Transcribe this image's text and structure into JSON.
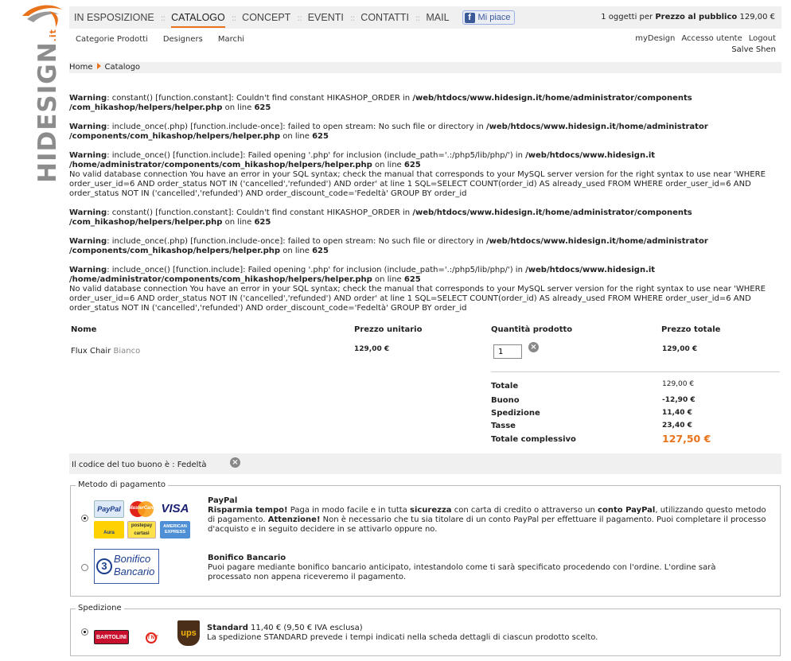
{
  "logo": {
    "brand": "HIDESIGN",
    "tld": ".it"
  },
  "nav": {
    "items": [
      {
        "label": "IN ESPOSIZIONE",
        "active": false
      },
      {
        "label": "CATALOGO",
        "active": true
      },
      {
        "label": "CONCEPT",
        "active": false
      },
      {
        "label": "EVENTI",
        "active": false
      },
      {
        "label": "CONTATTI",
        "active": false
      },
      {
        "label": "MAIL",
        "active": false
      }
    ],
    "separator": "::",
    "fb_like": "Mi piace",
    "cart": {
      "count_text": "1 oggetti per",
      "price_label": "Prezzo al pubblico",
      "total": "129,00 €"
    }
  },
  "subnav": [
    "Categorie Prodotti",
    "Designers",
    "Marchi"
  ],
  "usernav": [
    "myDesign",
    "Accesso utente",
    "Logout"
  ],
  "greeting": "Salve Shen",
  "breadcrumb": {
    "home": "Home",
    "current": "Catalogo"
  },
  "warnings": [
    {
      "label": "Warning",
      "text": ": constant() [function.constant]: Couldn't find constant HIKASHOP_ORDER in ",
      "path": "/web/htdocs/www.hidesign.it/home/administrator/components /com_hikashop/helpers/helper.php",
      "line_text": " on line ",
      "line": "625",
      "extra": ""
    },
    {
      "label": "Warning",
      "text": ": include_once(.php) [function.include-once]: failed to open stream: No such file or directory in ",
      "path": "/web/htdocs/www.hidesign.it/home/administrator /components/com_hikashop/helpers/helper.php",
      "line_text": " on line ",
      "line": "625",
      "extra": ""
    },
    {
      "label": "Warning",
      "text": ": include_once() [function.include]: Failed opening '.php' for inclusion (include_path='.:/php5/lib/php/') in ",
      "path": "/web/htdocs/www.hidesign.it /home/administrator/components/com_hikashop/helpers/helper.php",
      "line_text": " on line ",
      "line": "625",
      "extra": "No valid database connection You have an error in your SQL syntax; check the manual that corresponds to your MySQL server version for the right syntax to use near 'WHERE order_user_id=6 AND order_status NOT IN ('cancelled','refunded') AND order' at line 1 SQL=SELECT COUNT(order_id) AS already_used FROM WHERE order_user_id=6 AND order_status NOT IN ('cancelled','refunded') AND order_discount_code='Fedeltà' GROUP BY order_id"
    },
    {
      "label": "Warning",
      "text": ": constant() [function.constant]: Couldn't find constant HIKASHOP_ORDER in ",
      "path": "/web/htdocs/www.hidesign.it/home/administrator/components /com_hikashop/helpers/helper.php",
      "line_text": " on line ",
      "line": "625",
      "extra": ""
    },
    {
      "label": "Warning",
      "text": ": include_once(.php) [function.include-once]: failed to open stream: No such file or directory in ",
      "path": "/web/htdocs/www.hidesign.it/home/administrator /components/com_hikashop/helpers/helper.php",
      "line_text": " on line ",
      "line": "625",
      "extra": ""
    },
    {
      "label": "Warning",
      "text": ": include_once() [function.include]: Failed opening '.php' for inclusion (include_path='.:/php5/lib/php/') in ",
      "path": "/web/htdocs/www.hidesign.it /home/administrator/components/com_hikashop/helpers/helper.php",
      "line_text": " on line ",
      "line": "625",
      "extra": "No valid database connection You have an error in your SQL syntax; check the manual that corresponds to your MySQL server version for the right syntax to use near 'WHERE order_user_id=6 AND order_status NOT IN ('cancelled','refunded') AND order' at line 1 SQL=SELECT COUNT(order_id) AS already_used FROM WHERE order_user_id=6 AND order_status NOT IN ('cancelled','refunded') AND order_discount_code='Fedeltà' GROUP BY order_id"
    }
  ],
  "cart": {
    "headers": {
      "name": "Nome",
      "unit_price": "Prezzo unitario",
      "quantity": "Quantità prodotto",
      "total_price": "Prezzo totale"
    },
    "row": {
      "product": "Flux Chair",
      "variant": "Bianco",
      "unit_price": "129,00 €",
      "quantity": "1",
      "total": "129,00 €"
    },
    "totals": [
      {
        "label": "Totale",
        "value": "129,00 €"
      },
      {
        "label": "Buono",
        "value": "-12,90 €"
      },
      {
        "label": "Spedizione",
        "value": "11,40 €"
      },
      {
        "label": "Tasse",
        "value": "23,40 €"
      }
    ],
    "grand_total": {
      "label": "Totale complessivo",
      "value": "127,50 €"
    }
  },
  "coupon": {
    "text": "Il codice del tuo buono è : Fedeltà"
  },
  "payment": {
    "legend": "Metodo di pagamento",
    "paypal": {
      "title": "PayPal",
      "line1_b1": "Risparmia tempo!",
      "line1_t1": " Paga in modo facile e in tutta ",
      "line1_b2": "sicurezza",
      "line1_t2": " con carta di credito o attraverso un ",
      "line1_b3": "conto PayPal",
      "line1_t3": ", utilizzando questo metodo di pagamento. ",
      "line1_b4": "Attenzione!",
      "line1_t4": " Non è necessario che tu sia titolare di un conto PayPal per effettuare il pagamento. Puoi completare il processo d'acquisto e in seguito decidere in se attivarlo oppure no."
    },
    "bonifico": {
      "title": "Bonifico Bancario",
      "text": "Puoi pagare mediante bonifico bancario anticipato, intestandolo come ti sarà specificato procedendo con l'ordine. L'ordine sarà processato non appena riceveremo il pagamento.",
      "logo_line1": "Bonifico",
      "logo_line2": "Bancario",
      "logo_num": "3"
    },
    "cards": {
      "paypal": "PayPal",
      "mastercard": "MasterCard",
      "visa": "VISA",
      "postepay": "postepay",
      "amex": "AMERICAN EXPRESS",
      "aura": "Aura",
      "carta": "cartasì"
    }
  },
  "shipping": {
    "legend": "Spedizione",
    "title": "Standard",
    "price": " 11,40 € (9,50 € IVA esclusa)",
    "text": "La spedizione STANDARD prevede i tempi indicati nella scheda dettagli di ciascun prodotto scelto.",
    "carriers": {
      "bartolini": "BARTOLINI",
      "tnt": "TNT",
      "ups": "ups"
    }
  },
  "colors": {
    "accent": "#e8731a",
    "nav_bg": "#f0f0f0",
    "logo_gray": "#8c8c8c",
    "facebook": "#3b5998"
  }
}
